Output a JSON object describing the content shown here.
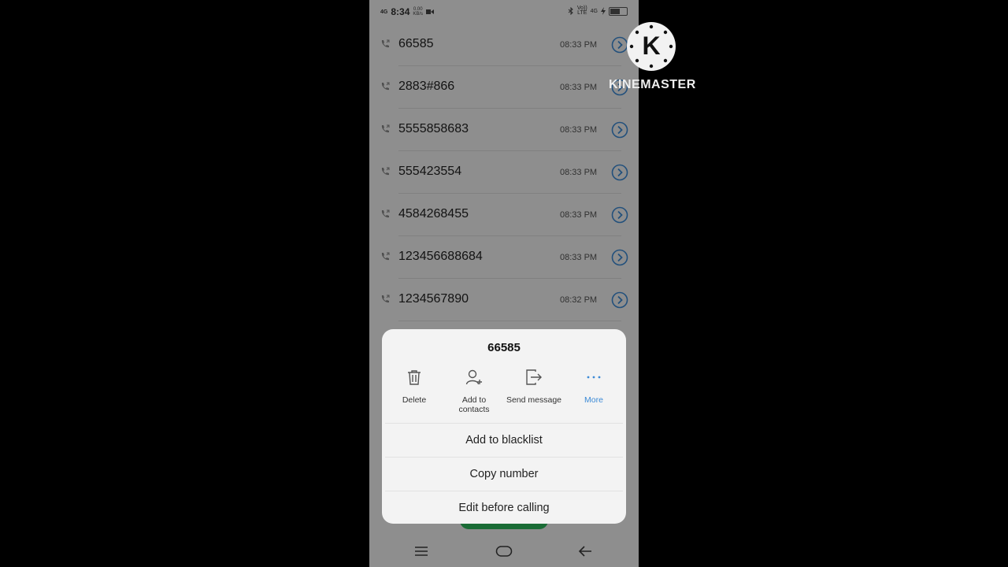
{
  "status_bar": {
    "network": "4G",
    "time": "8:34",
    "data_rate_value": "0.00",
    "data_rate_unit": "KB/s",
    "volte_top": "Vo))",
    "volte_bottom": "LTE",
    "network_right": "4G"
  },
  "calls": [
    {
      "number": "66585",
      "time": "08:33 PM"
    },
    {
      "number": "2883#866",
      "time": "08:33 PM"
    },
    {
      "number": "5555858683",
      "time": "08:33 PM"
    },
    {
      "number": "555423554",
      "time": "08:33 PM"
    },
    {
      "number": "4584268455",
      "time": "08:33 PM"
    },
    {
      "number": "123456688684",
      "time": "08:33 PM"
    },
    {
      "number": "1234567890",
      "time": "08:32 PM"
    }
  ],
  "sheet": {
    "title": "66585",
    "actions": [
      {
        "label": "Delete",
        "icon": "trash-icon"
      },
      {
        "label_line1": "Add to",
        "label_line2": "contacts",
        "icon": "add-contact-icon"
      },
      {
        "label": "Send message",
        "icon": "send-message-icon"
      },
      {
        "label": "More",
        "icon": "more-dots-icon"
      }
    ],
    "menu": [
      "Add to blacklist",
      "Copy number",
      "Edit before calling"
    ]
  },
  "watermark": {
    "letter": "K",
    "text": "KINEMASTER"
  },
  "colors": {
    "accent": "#3c8ad6",
    "call_green": "#2dbb5d"
  }
}
